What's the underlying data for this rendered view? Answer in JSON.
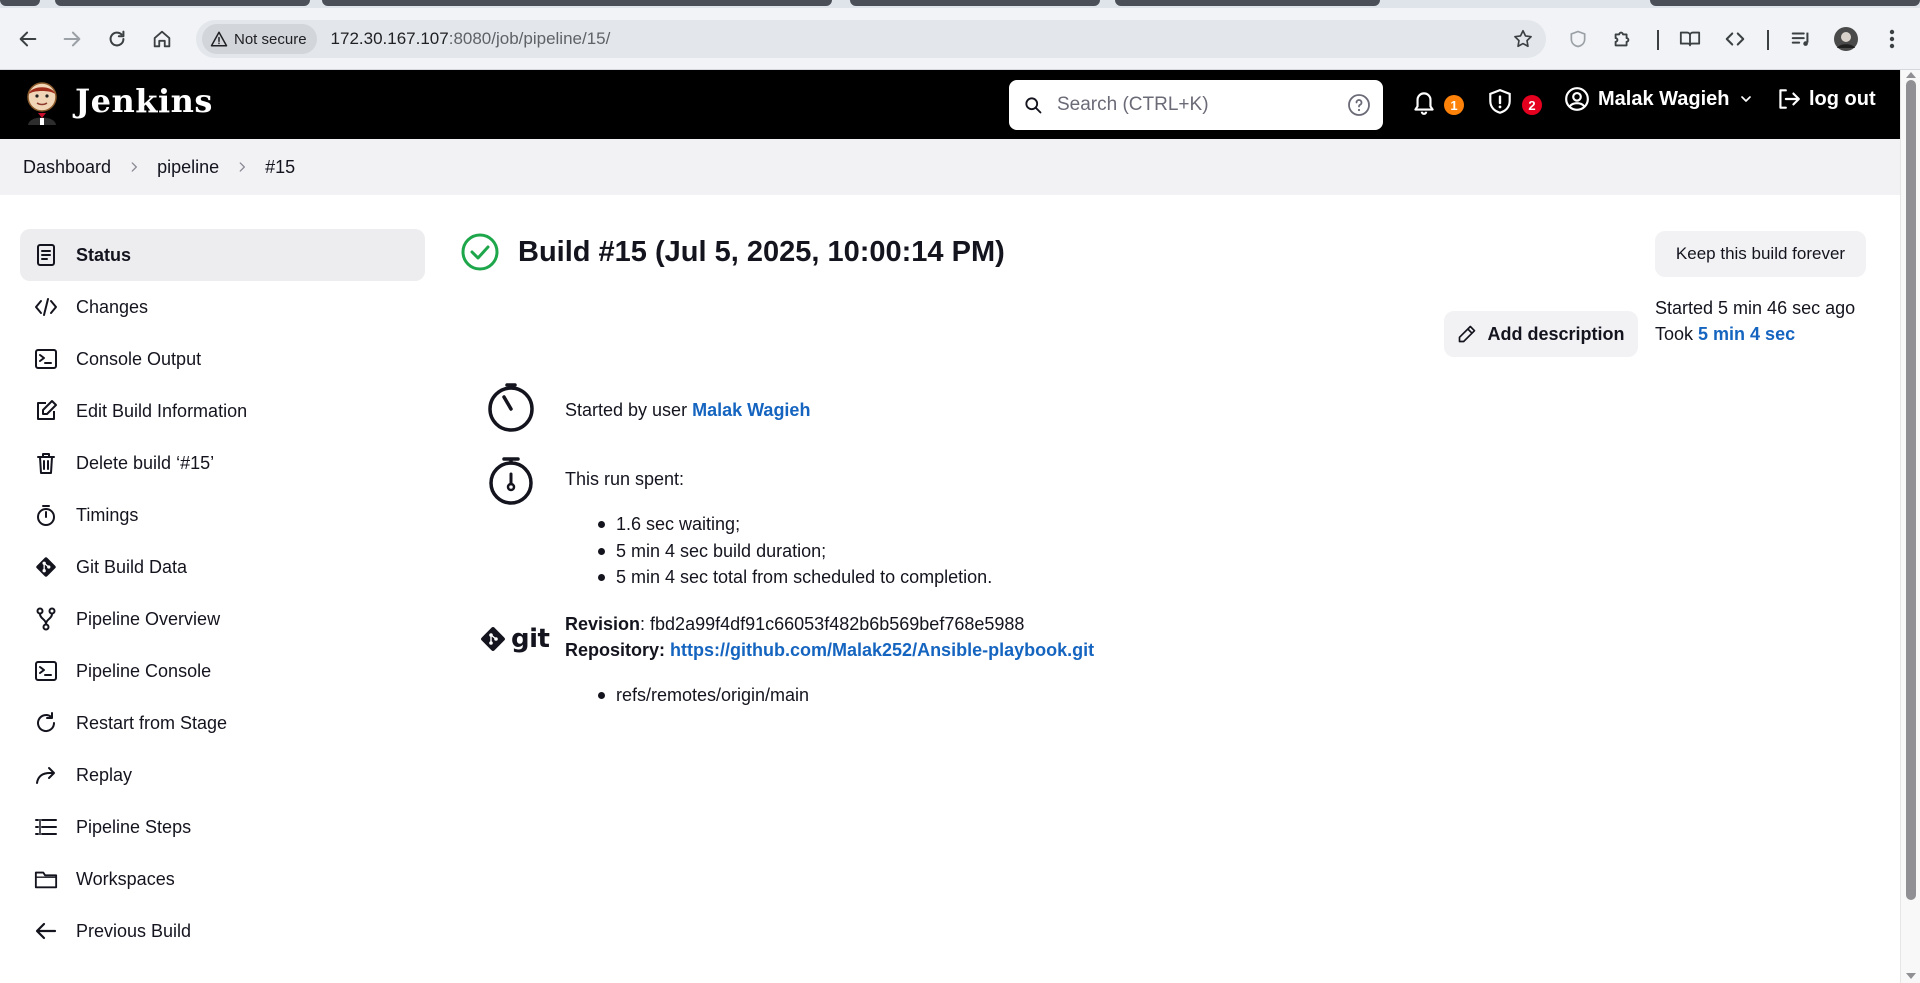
{
  "browser": {
    "security_label": "Not secure",
    "url_host": "172.30.167.107",
    "url_rest": ":8080/job/pipeline/15/"
  },
  "header": {
    "brand": "Jenkins",
    "search_placeholder": "Search (CTRL+K)",
    "notifications_count": "1",
    "security_count": "2",
    "user_name": "Malak Wagieh",
    "logout_label": "log out",
    "colors": {
      "notif_badge": "#fe820a",
      "security_badge": "#e6001f"
    }
  },
  "breadcrumb": {
    "items": [
      "Dashboard",
      "pipeline",
      "#15"
    ]
  },
  "sidebar": {
    "items": [
      {
        "label": "Status",
        "icon": "document-icon",
        "active": true
      },
      {
        "label": "Changes",
        "icon": "code-icon"
      },
      {
        "label": "Console Output",
        "icon": "terminal-icon"
      },
      {
        "label": "Edit Build Information",
        "icon": "edit-icon"
      },
      {
        "label": "Delete build ‘#15’",
        "icon": "trash-icon"
      },
      {
        "label": "Timings",
        "icon": "stopwatch-icon"
      },
      {
        "label": "Git Build Data",
        "icon": "git-icon"
      },
      {
        "label": "Pipeline Overview",
        "icon": "branch-icon"
      },
      {
        "label": "Pipeline Console",
        "icon": "terminal-icon"
      },
      {
        "label": "Restart from Stage",
        "icon": "restart-icon"
      },
      {
        "label": "Replay",
        "icon": "replay-icon"
      },
      {
        "label": "Pipeline Steps",
        "icon": "list-icon"
      },
      {
        "label": "Workspaces",
        "icon": "folder-icon"
      },
      {
        "label": "Previous Build",
        "icon": "arrow-left-icon"
      }
    ]
  },
  "build": {
    "title": "Build #15 (Jul 5, 2025, 10:00:14 PM)",
    "status_color": "#1ea64b",
    "keep_label": "Keep this build forever",
    "add_description_label": "Add description",
    "started_ago": "Started 5 min 46 sec ago",
    "took_prefix": "Took ",
    "took_value": "5 min 4 sec",
    "started_by_prefix": "Started by user ",
    "started_by_user": "Malak Wagieh",
    "run_spent_label": "This run spent:",
    "run_spent_items": [
      "1.6 sec waiting;",
      "5 min 4 sec build duration;",
      "5 min 4 sec total from scheduled to completion."
    ],
    "git_word": "git",
    "revision_label": "Revision",
    "revision_value": ": fbd2a99f4df91c66053f482b6b569bef768e5988",
    "repository_label": "Repository",
    "repository_url": "https://github.com/Malak252/Ansible-playbook.git",
    "refs": [
      "refs/remotes/origin/main"
    ]
  },
  "link_color": "#1565c0"
}
